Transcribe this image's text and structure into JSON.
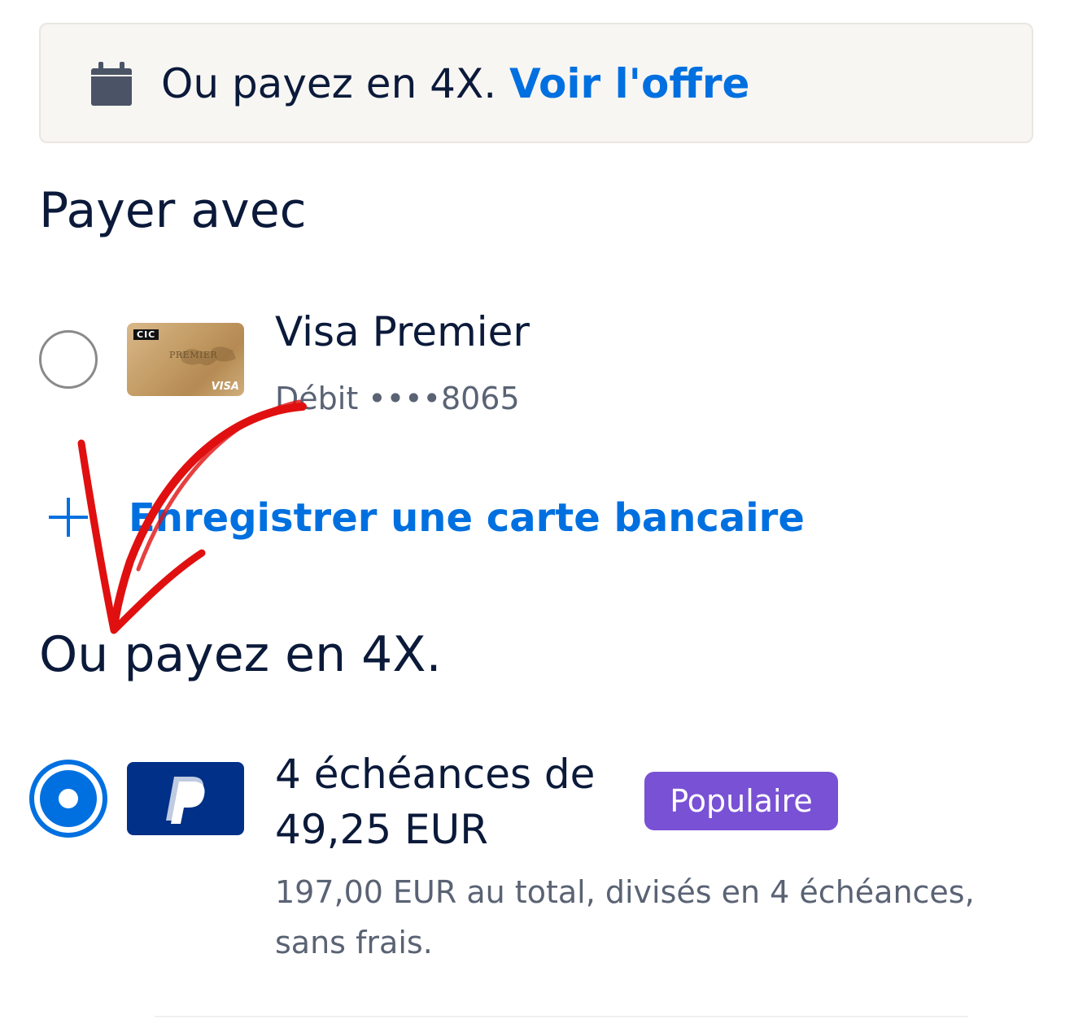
{
  "colors": {
    "accent": "#0070e0",
    "text_primary": "#0b1a3a",
    "text_secondary": "#5a6374",
    "banner_bg": "#f8f6f3",
    "badge_bg": "#7951d4",
    "paypal_blue": "#003087",
    "annotation_arrow": "#e01010"
  },
  "banner": {
    "icon": "calendar-icon",
    "text": "Ou payez en 4X. ",
    "link_label": "Voir l'offre"
  },
  "pay_with": {
    "title": "Payer avec",
    "card": {
      "selected": false,
      "card_image": {
        "bank_text": "CIC",
        "tier_text": "PREMIER",
        "network_text": "VISA"
      },
      "name": "Visa Premier",
      "subtitle": "Débit ••••8065"
    },
    "add_card": {
      "icon": "plus-icon",
      "label": "Enregistrer une carte bancaire"
    }
  },
  "pay_in_4": {
    "title": "Ou payez en 4X.",
    "option": {
      "selected": true,
      "logo": "paypal-icon",
      "installments_label": "4 échéances de 49,25 EUR",
      "badge": "Populaire",
      "details": "197,00 EUR au total, divisés en 4 échéances, sans frais."
    }
  }
}
